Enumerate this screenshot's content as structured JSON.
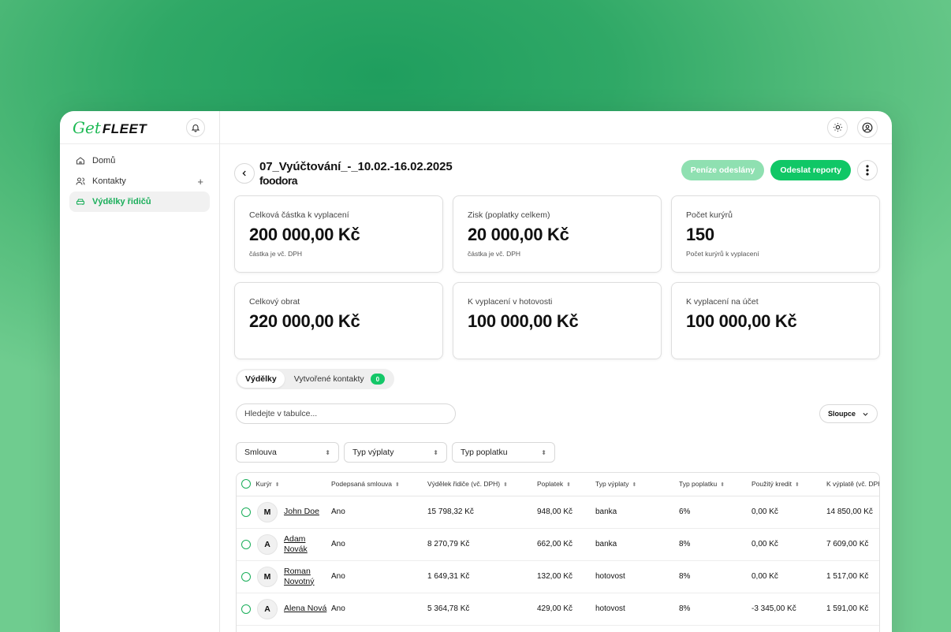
{
  "logo": {
    "get": "Get",
    "fleet": "FLEET"
  },
  "sidebar": {
    "items": [
      {
        "label": "Domů",
        "icon": "home-icon"
      },
      {
        "label": "Kontakty",
        "icon": "contacts-icon",
        "action": "+"
      },
      {
        "label": "Výdělky řidičů",
        "icon": "car-icon",
        "active": true
      }
    ]
  },
  "header": {
    "title": "07_Vyúčtování_-_10.02.-16.02.2025",
    "brand": "foodora",
    "btn_sent": "Peníze odeslány",
    "btn_report": "Odeslat reporty"
  },
  "cards": [
    {
      "label": "Celková částka k vyplacení",
      "value": "200 000,00 Kč",
      "sub": "částka je vč. DPH"
    },
    {
      "label": "Zisk (poplatky celkem)",
      "value": "20 000,00 Kč",
      "sub": "částka je vč. DPH"
    },
    {
      "label": "Počet kurýrů",
      "value": "150",
      "sub": "Počet kurýrů k vyplacení"
    },
    {
      "label": "Celkový obrat",
      "value": "220 000,00 Kč",
      "sub": ""
    },
    {
      "label": "K vyplacení v hotovosti",
      "value": "100 000,00 Kč",
      "sub": ""
    },
    {
      "label": "K vyplacení na účet",
      "value": "100 000,00 Kč",
      "sub": ""
    }
  ],
  "tabs": [
    {
      "label": "Výdělky",
      "active": true
    },
    {
      "label": "Vytvořené kontakty",
      "badge": "0"
    }
  ],
  "search": {
    "placeholder": "Hledejte v tabulce..."
  },
  "columns_button": "Sloupce",
  "filters": [
    "Smlouva",
    "Typ výplaty",
    "Typ poplatku"
  ],
  "table": {
    "headers": [
      "Kurýr",
      "Podepsaná smlouva",
      "Výdělek řidiče (vč. DPH)",
      "Poplatek",
      "Typ výplaty",
      "Typ poplatku",
      "Použitý kredit",
      "K výplatě (vč. DPH)"
    ],
    "rows": [
      {
        "initial": "M",
        "name": "John Doe",
        "contract": "Ano",
        "earnings": "15 798,32 Kč",
        "fee": "948,00 Kč",
        "payout": "banka",
        "fee_type": "6%",
        "credit": "0,00 Kč",
        "to_pay": "14 850,00 Kč"
      },
      {
        "initial": "A",
        "name": "Adam Novák",
        "contract": "Ano",
        "earnings": "8 270,79 Kč",
        "fee": "662,00 Kč",
        "payout": "banka",
        "fee_type": "8%",
        "credit": "0,00 Kč",
        "to_pay": "7 609,00 Kč"
      },
      {
        "initial": "M",
        "name": "Roman Novotný",
        "contract": "Ano",
        "earnings": "1 649,31 Kč",
        "fee": "132,00 Kč",
        "payout": "hotovost",
        "fee_type": "8%",
        "credit": "0,00 Kč",
        "to_pay": "1 517,00 Kč"
      },
      {
        "initial": "A",
        "name": "Alena Nová",
        "contract": "Ano",
        "earnings": "5 364,78 Kč",
        "fee": "429,00 Kč",
        "payout": "hotovost",
        "fee_type": "8%",
        "credit": "-3 345,00 Kč",
        "to_pay": "1 591,00 Kč"
      }
    ]
  },
  "colors": {
    "accent": "#10c766",
    "accent_light": "#8fe0b1",
    "active_text": "#1aae5a"
  }
}
